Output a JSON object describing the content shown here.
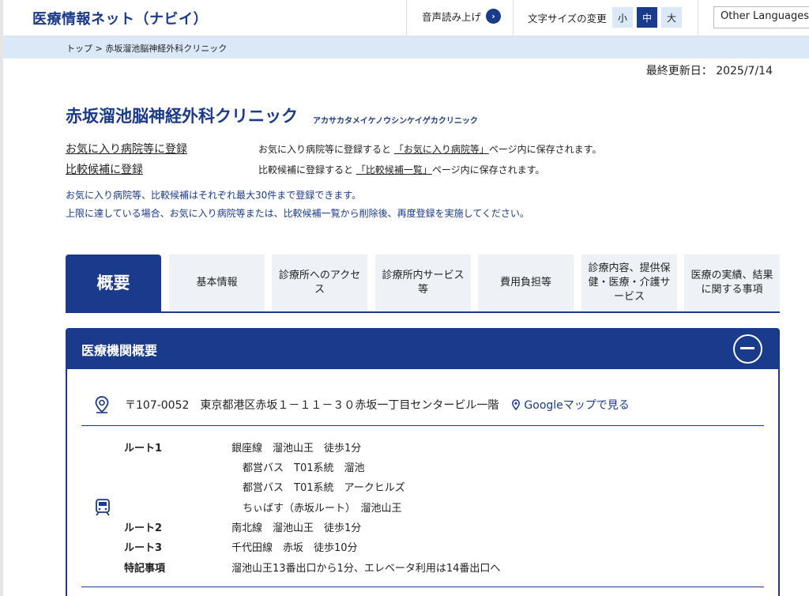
{
  "header": {
    "site_title": "医療情報ネット（ナビイ）",
    "voice_label": "音声読み上げ",
    "font_size_label": "文字サイズの変更",
    "font_sizes": [
      "小",
      "中",
      "大"
    ],
    "font_size_selected": "中",
    "language_button": "Other Languages"
  },
  "breadcrumb": {
    "home": "トップ",
    "separator": ">",
    "current": "赤坂溜池脳神経外科クリニック"
  },
  "last_updated": "最終更新日：  2025/7/14",
  "clinic": {
    "name": "赤坂溜池脳神経外科クリニック",
    "kana": "アカサカタメイケノウシンケイゲカクリニック"
  },
  "registration": {
    "favorite_link": "お気に入り病院等に登録",
    "favorite_desc_pre": "お気に入り病院等に登録すると",
    "favorite_desc_link": "「お気に入り病院等」",
    "favorite_desc_post": "ページ内に保存されます。",
    "compare_link": "比較候補に登録",
    "compare_desc_pre": "比較候補に登録すると",
    "compare_desc_link": "「比較候補一覧」",
    "compare_desc_post": "ページ内に保存されます。",
    "note1": "お気に入り病院等、比較候補はそれぞれ最大30件まで登録できます。",
    "note2": "上限に達している場合、お気に入り病院等または、比較候補一覧から削除後、再度登録を実施してください。"
  },
  "tabs": [
    {
      "label": "概要",
      "active": true
    },
    {
      "label": "基本情報"
    },
    {
      "label": "診療所へのアクセス"
    },
    {
      "label": "診療所内サービス等"
    },
    {
      "label": "費用負担等"
    },
    {
      "label": "診療内容、提供保健・医療・介護サービス"
    },
    {
      "label": "医療の実績、結果に関する事項"
    }
  ],
  "panel": {
    "title": "医療機関概要",
    "address": "〒107-0052　東京都港区赤坂１－１１－３０赤坂一丁目センタービル一階",
    "map_link": "Googleマップで見る",
    "routes": [
      {
        "label": "ルート1",
        "lines": [
          "銀座線　溜池山王　徒歩1分",
          "都営バス　T01系統　溜池",
          "都営バス　T01系統　アークヒルズ",
          "ちぃばす（赤坂ルート）　溜池山王"
        ]
      },
      {
        "label": "ルート2",
        "lines": [
          "南北線　溜池山王　徒歩1分"
        ]
      },
      {
        "label": "ルート3",
        "lines": [
          "千代田線　赤坂　徒歩10分"
        ]
      },
      {
        "label": "特記事項",
        "lines": [
          "溜池山王13番出口から1分、エレベータ利用は14番出口へ"
        ]
      }
    ]
  },
  "colors": {
    "brand": "#1a3a8c",
    "light_bg": "#dbe8f7",
    "tab_bg": "#eef2f7"
  },
  "icons": [
    "chevron-right-icon",
    "pin-icon",
    "train-icon",
    "minus-circle-icon"
  ]
}
